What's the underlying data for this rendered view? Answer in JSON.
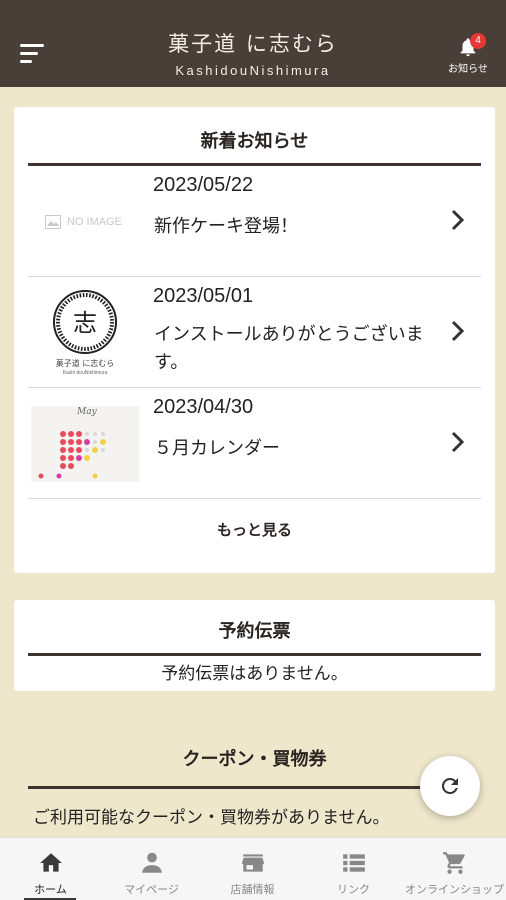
{
  "header": {
    "brand_title": "菓子道 に志むら",
    "brand_sub": "KashidouNishimura",
    "notice_badge": "4",
    "notice_label": "お知らせ"
  },
  "news": {
    "title": "新着お知らせ",
    "items": [
      {
        "date": "2023/05/22",
        "text": "新作ケーキ登場！",
        "thumb": "no-image",
        "thumb_label": "NO IMAGE"
      },
      {
        "date": "2023/05/01",
        "text": "インストールありがとうございます。",
        "thumb": "shop-logo",
        "logo_caption": "菓子道 に志むら",
        "logo_sub": "Kashi douNishimura"
      },
      {
        "date": "2023/04/30",
        "text": "５月カレンダー",
        "thumb": "calendar",
        "calendar_heading": "May"
      }
    ],
    "more_label": "もっと見る"
  },
  "reservation": {
    "title": "予約伝票",
    "empty_text": "予約伝票はありません。"
  },
  "coupon": {
    "title": "クーポン・買物券",
    "empty_text": "ご利用可能なクーポン・買物券がありません。"
  },
  "tabs": [
    {
      "label": "ホーム",
      "icon": "home-icon",
      "active": true
    },
    {
      "label": "マイページ",
      "icon": "person-icon",
      "active": false
    },
    {
      "label": "店舗情報",
      "icon": "store-icon",
      "active": false
    },
    {
      "label": "リンク",
      "icon": "list-icon",
      "active": false
    },
    {
      "label": "オンラインショップ",
      "icon": "cart-icon",
      "active": false
    }
  ],
  "colors": {
    "header_bg": "#4a3f38",
    "page_bg": "#efe7cb",
    "badge": "#e53935",
    "rule": "#3e342f"
  }
}
